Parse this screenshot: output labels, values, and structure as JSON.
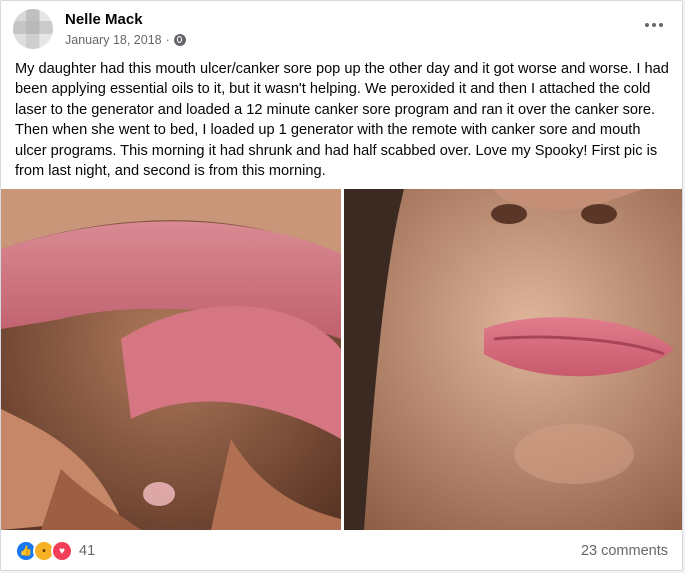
{
  "post": {
    "author": "Nelle Mack",
    "date": "January 18, 2018",
    "dot": "·",
    "privacy_icon": "globe-icon",
    "more_icon": "more-options-icon",
    "text": "My daughter  had this mouth ulcer/canker sore pop up the other day and it got worse and worse. I had been applying essential oils to it, but it wasn't  helping. We peroxided it and then I attached the cold laser to the generator  and loaded a 12 minute  canker sore program and ran it over the canker sore. Then when she went to bed, I loaded up 1 generator with the remote with canker sore and mouth ulcer programs. This morning it had shrunk and had half scabbed over. Love my Spooky! First pic is from last night, and second is from this morning."
  },
  "photos": [
    {
      "name": "photo-lip-before"
    },
    {
      "name": "photo-lip-after"
    }
  ],
  "footer": {
    "reactions": [
      {
        "icon": "like-icon",
        "color": "#1877f2"
      },
      {
        "icon": "wow-icon",
        "color": "#f7b125"
      },
      {
        "icon": "love-icon",
        "color": "#f33e58"
      }
    ],
    "reaction_count": "41",
    "comments": "23 comments"
  }
}
